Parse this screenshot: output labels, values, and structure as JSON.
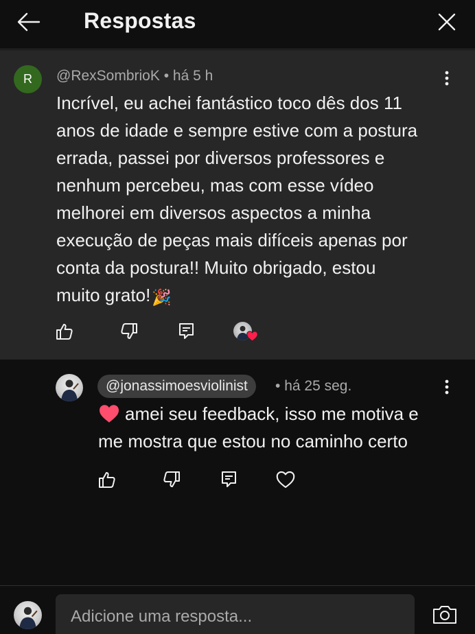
{
  "header": {
    "title": "Respostas",
    "back_icon": "arrow-left-icon",
    "close_icon": "close-icon"
  },
  "parent_comment": {
    "avatar_letter": "R",
    "avatar_color": "#33691e",
    "author": "@RexSombrioK",
    "separator": "•",
    "time": "há 5 h",
    "lines": [
      "Incrível, eu achei fantástico toco dês dos 11",
      "anos de idade e sempre estive com a postura",
      "errada, passei por diversos professores e",
      "nenhum percebeu, mas com esse vídeo",
      "melhorei em diversos aspectos a minha",
      "execução de peças mais difíceis apenas por",
      "conta da postura!! Muito obrigado, estou",
      "muito grato!"
    ],
    "emoji": "🎉",
    "actions": [
      "like-icon",
      "dislike-icon",
      "reply-icon",
      "creator-heart-icon"
    ]
  },
  "reply": {
    "author": "@jonassimoesviolinist",
    "separator": "•",
    "time": "há 25 seg.",
    "lines": [
      "amei seu feedback, isso me motiva e",
      "me mostra que estou no caminho certo"
    ],
    "actions": [
      "like-icon",
      "dislike-icon",
      "reply-icon",
      "heart-icon"
    ]
  },
  "composer": {
    "placeholder": "Adicione uma resposta...",
    "camera_icon": "camera-icon"
  },
  "colors": {
    "background": "#0f0f0f",
    "comment_highlight": "#272727",
    "heart_red": "#ff4d6d",
    "secondary_text": "#aaaaaa"
  }
}
